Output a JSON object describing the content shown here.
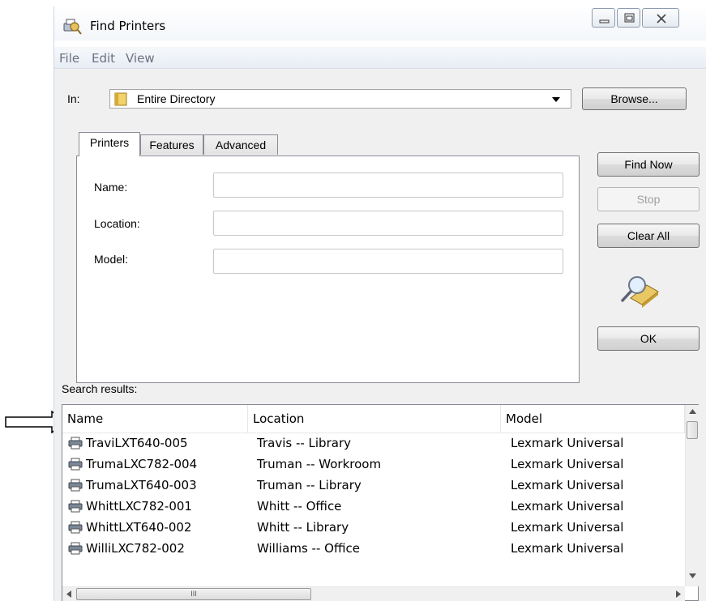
{
  "window": {
    "title": "Find Printers",
    "controls": {
      "minimize": "minimize-icon",
      "maximize": "maximize-icon",
      "close": "close-icon"
    }
  },
  "menu": [
    "File",
    "Edit",
    "View"
  ],
  "in_label": "In:",
  "scope": {
    "value": "Entire Directory",
    "icon": "directory-book-icon"
  },
  "browse_label": "Browse...",
  "tabs": [
    "Printers",
    "Features",
    "Advanced"
  ],
  "active_tab": "Printers",
  "fields": [
    {
      "label": "Name:",
      "value": ""
    },
    {
      "label": "Location:",
      "value": ""
    },
    {
      "label": "Model:",
      "value": ""
    }
  ],
  "buttons": {
    "find_now": "Find Now",
    "stop": "Stop",
    "clear_all": "Clear All",
    "ok": "OK"
  },
  "search_icon": "magnifier-search-icon",
  "results_label": "Search results:",
  "columns": [
    "Name",
    "Location",
    "Model"
  ],
  "rows": [
    {
      "name": "TraviLXT640-005",
      "location": "Travis -- Library",
      "model": "Lexmark Universal"
    },
    {
      "name": "TrumaLXC782-004",
      "location": "Truman -- Workroom",
      "model": "Lexmark Universal"
    },
    {
      "name": "TrumaLXT640-003",
      "location": "Truman -- Library",
      "model": "Lexmark Universal"
    },
    {
      "name": "WhittLXC782-001",
      "location": "Whitt -- Office",
      "model": "Lexmark Universal"
    },
    {
      "name": "WhittLXT640-002",
      "location": "Whitt -- Library",
      "model": "Lexmark Universal"
    },
    {
      "name": "WilliLXC782-002",
      "location": "Williams -- Office",
      "model": "Lexmark Universal"
    }
  ],
  "row_icon": "printer-icon",
  "hscroll_thumb_glyph": "III"
}
